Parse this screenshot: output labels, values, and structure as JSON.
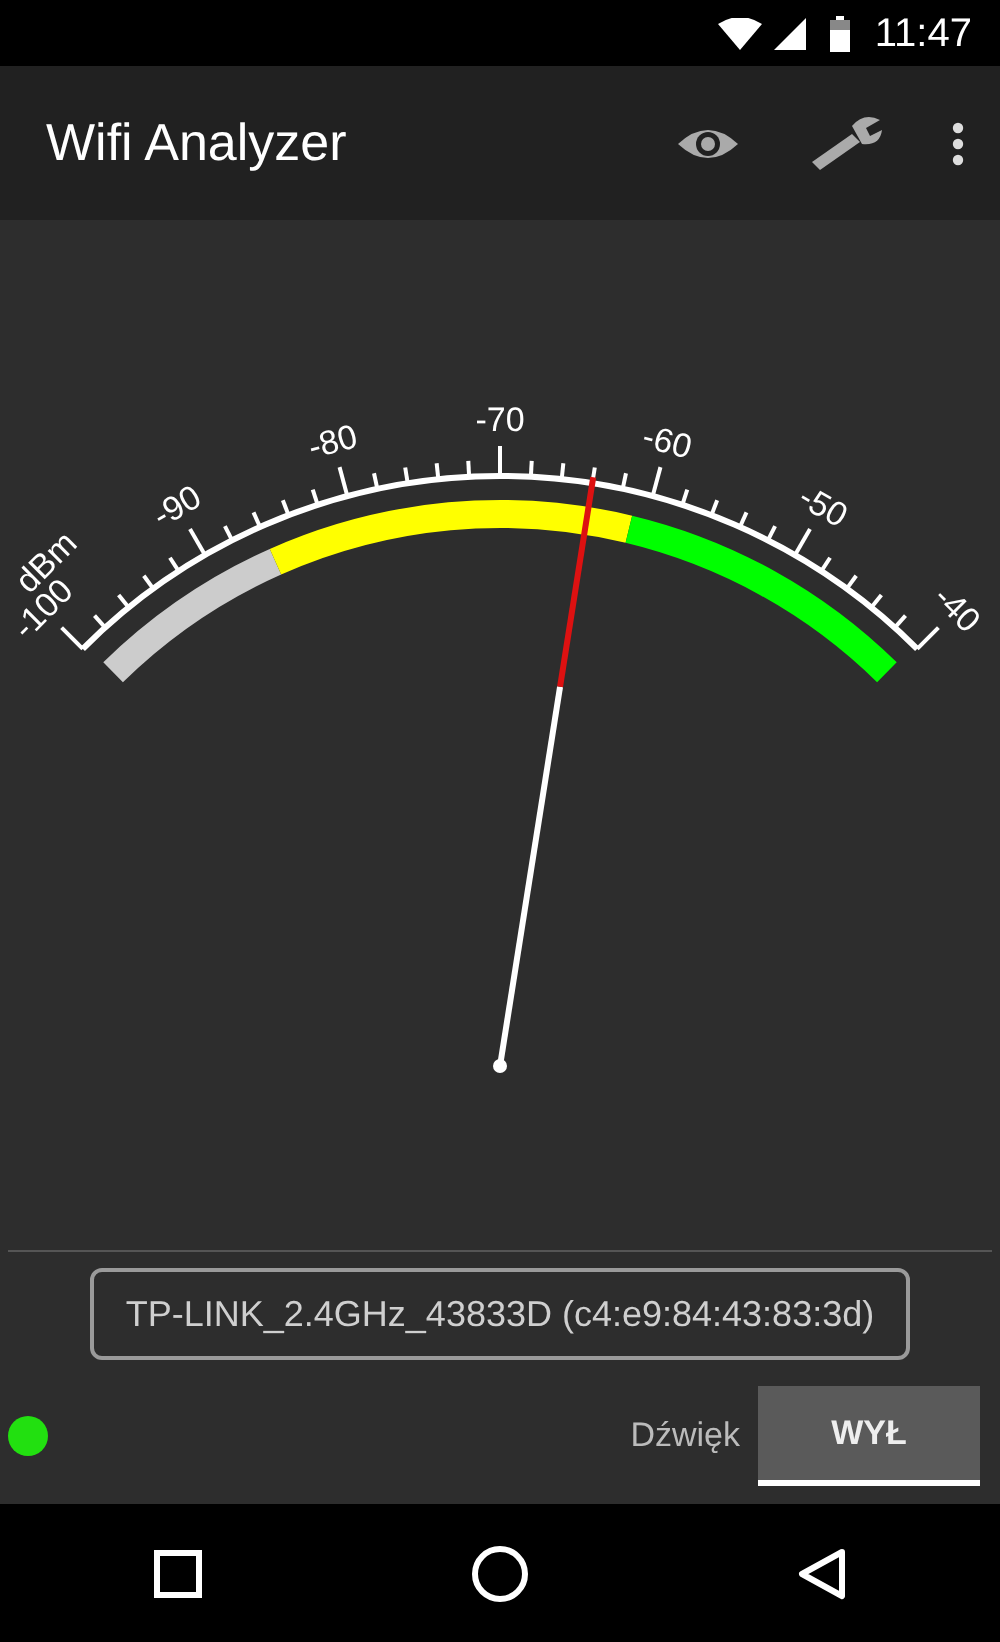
{
  "status_bar": {
    "time": "11:47"
  },
  "app_bar": {
    "title": "Wifi Analyzer"
  },
  "gauge": {
    "unit": "dBm",
    "ticks": [
      "-100",
      "-90",
      "-80",
      "-70",
      "-60",
      "-50",
      "-40"
    ]
  },
  "network": {
    "label": "TP-LINK_2.4GHz_43833D (c4:e9:84:43:83:3d)"
  },
  "footer": {
    "connected": true,
    "sound_label": "Dźwięk",
    "toggle": {
      "label": "WYŁ",
      "on": false
    }
  }
}
